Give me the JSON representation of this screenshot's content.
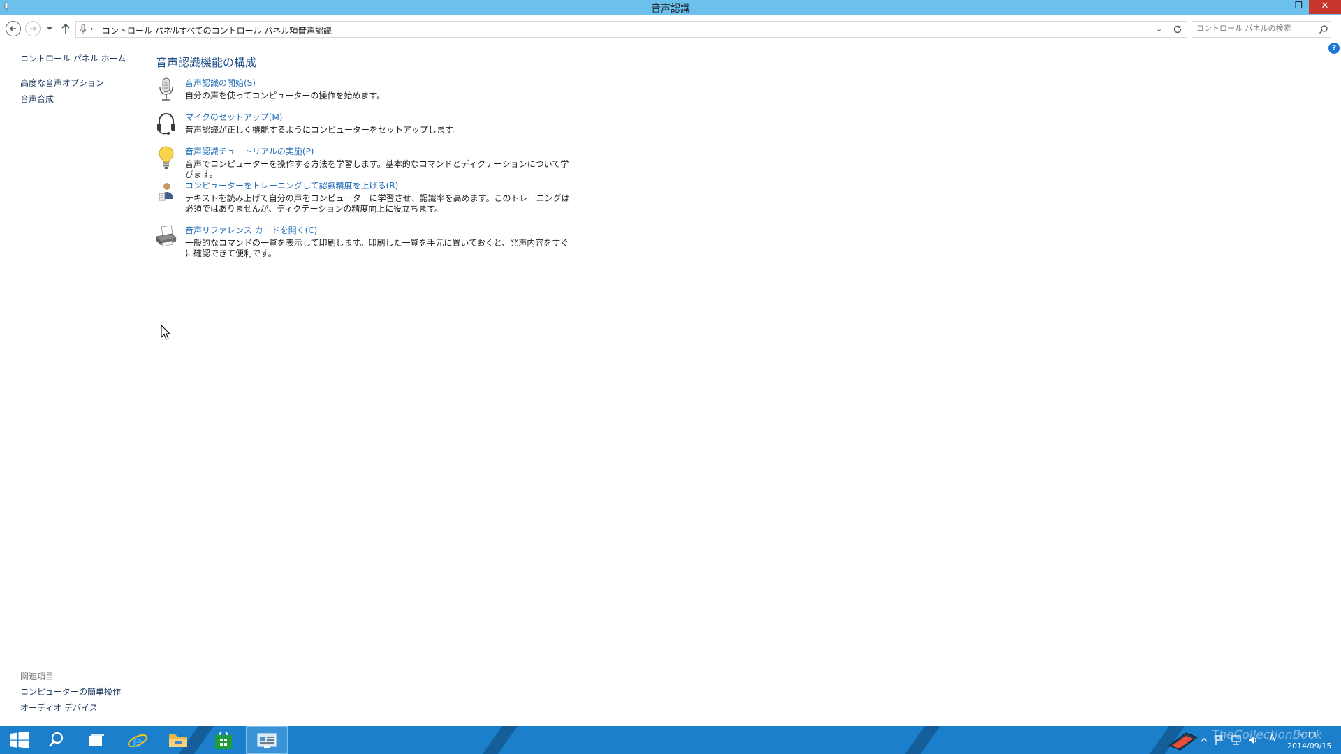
{
  "window": {
    "title": "音声認識",
    "minimize_label": "–",
    "maximize_label": "❐",
    "close_label": "✕"
  },
  "address": {
    "breadcrumbs": [
      "コントロール パネル",
      "すべてのコントロール パネル項目",
      "音声認識"
    ],
    "separator": "›",
    "dropdown_label": "⌄"
  },
  "search": {
    "placeholder": "コントロール パネルの検索"
  },
  "help": {
    "label": "?"
  },
  "sidebar": {
    "home": "コントロール パネル ホーム",
    "items": [
      {
        "label": "高度な音声オプション"
      },
      {
        "label": "音声合成"
      }
    ],
    "related_heading": "関連項目",
    "related": [
      {
        "label": "コンピューターの簡単操作"
      },
      {
        "label": "オーディオ デバイス"
      }
    ]
  },
  "main": {
    "title": "音声認識機能の構成",
    "tasks": [
      {
        "icon": "microphone-icon",
        "link": "音声認識の開始(S)",
        "desc": "自分の声を使ってコンピューターの操作を始めます。"
      },
      {
        "icon": "headset-icon",
        "link": "マイクのセットアップ(M)",
        "desc": "音声認識が正しく機能するようにコンピューターをセットアップします。"
      },
      {
        "icon": "lightbulb-icon",
        "link": "音声認識チュートリアルの実施(P)",
        "desc": "音声でコンピューターを操作する方法を学習します。基本的なコマンドとディクテーションについて学びます。"
      },
      {
        "icon": "user-training-icon",
        "link": "コンピューターをトレーニングして認識精度を上げる(R)",
        "desc": "テキストを読み上げて自分の声をコンピューターに学習させ、認識率を高めます。このトレーニングは必須ではありませんが、ディクテーションの精度向上に役立ちます。"
      },
      {
        "icon": "printer-icon",
        "link": "音声リファレンス カードを開く(C)",
        "desc": "一般的なコマンドの一覧を表示して印刷します。印刷した一覧を手元に置いておくと、発声内容をすぐに確認できて便利です。"
      }
    ]
  },
  "taskbar": {
    "clock_time": "9:13",
    "clock_date": "2014/09/15",
    "ime_label": "A",
    "watermark": "TheCollectionBook",
    "colors": {
      "bar": "#1b7fcb",
      "active": "#3a93d6"
    }
  }
}
